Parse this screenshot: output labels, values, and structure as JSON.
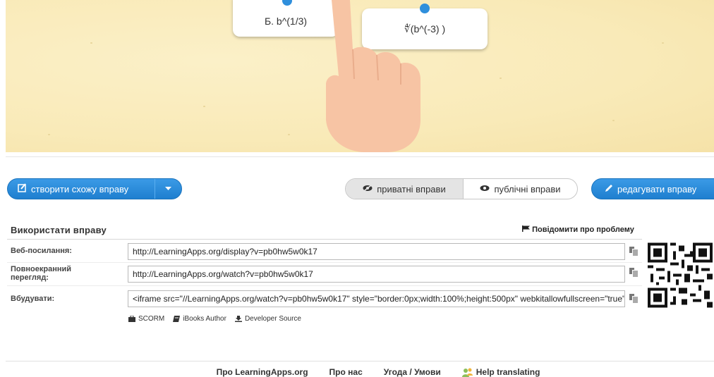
{
  "preview": {
    "card_b": "Б. b^(1/3)",
    "card_root": "∜(b^(-3) )"
  },
  "toolbar": {
    "create_label": "створити схожу вправу",
    "private_label": "приватні вправи",
    "public_label": "публічні вправи",
    "edit_label": "редагувати вправу"
  },
  "use": {
    "title": "Використати вправу",
    "report": "Повідомити про проблему",
    "rows": [
      {
        "label": "Веб-посилання:",
        "value": "http://LearningApps.org/display?v=pb0hw5w0k17"
      },
      {
        "label": "Повноекранний перегляд:",
        "value": "http://LearningApps.org/watch?v=pb0hw5w0k17"
      },
      {
        "label": "Вбудувати:",
        "value": "<iframe src=\"//LearningApps.org/watch?v=pb0hw5w0k17\" style=\"border:0px;width:100%;height:500px\" webkitallowfullscreen=\"true\" mozallowfullscreen=\"true\"></iframe>"
      }
    ],
    "exports": [
      "SCORM",
      "iBooks Author",
      "Developer Source"
    ]
  },
  "footer": {
    "about": "Про LearningApps.org",
    "us": "Про нас",
    "terms": "Угода / Умови",
    "help": "Help translating"
  },
  "colors": {
    "accent": "#1f7fcf",
    "preview_bg": "#f9eab8",
    "hand": "#f7c4a4"
  }
}
